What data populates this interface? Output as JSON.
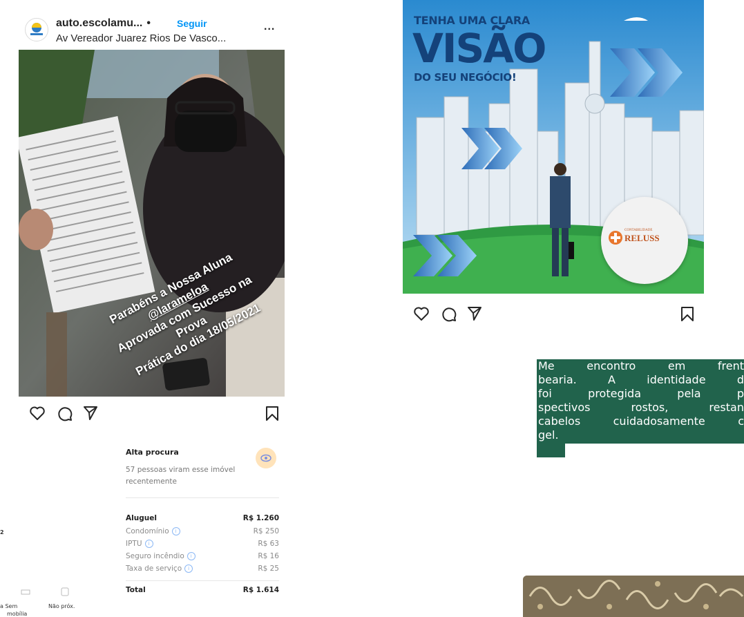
{
  "post1": {
    "username": "auto.escolamu...",
    "separator": "•",
    "follow_label": "Seguir",
    "location": "Av Vereador Juarez Rios De Vasco...",
    "more_label": "...",
    "caption": {
      "line1": "Parabéns a Nossa Aluna",
      "line2": "@larameloa",
      "line3": "Aprovada com Sucesso na Prova",
      "line4": "Prática do dia 18/05/2021"
    },
    "actions": [
      "heart-icon",
      "comment-icon",
      "share-icon",
      "bookmark-icon"
    ]
  },
  "post2": {
    "banner": {
      "title_top": "TENHA UMA CLARA",
      "title_main": "VISÃO",
      "title_bottom": "DO SEU NEGÓCIO!"
    },
    "logo": {
      "small_text": "CONTABILIDADE",
      "brand": "RELUSS"
    },
    "actions": [
      "heart-icon",
      "comment-icon",
      "share-icon",
      "bookmark-icon"
    ]
  },
  "greenbox": {
    "bg_color": "#21634c",
    "lines": [
      [
        "Me",
        "encontro",
        "em",
        "frent"
      ],
      [
        "bearia.",
        "A",
        "identidade",
        "d"
      ],
      [
        "foi",
        "protegida",
        "pela",
        "p"
      ],
      [
        "spectivos",
        "rostos,",
        "restan"
      ],
      [
        "cabelos",
        "cuidadosamente",
        "c"
      ],
      [
        "gel."
      ]
    ]
  },
  "rental": {
    "demand_title": "Alta procura",
    "demand_desc": "57 pessoas viram esse imóvel recentemente",
    "rows": [
      {
        "label": "Aluguel",
        "value": "R$ 1.260",
        "info": false,
        "bold": true
      },
      {
        "label": "Condomínio",
        "value": "R$ 250",
        "info": true,
        "bold": false
      },
      {
        "label": "IPTU",
        "value": "R$ 63",
        "info": true,
        "bold": false
      },
      {
        "label": "Seguro incêndio",
        "value": "R$ 16",
        "info": true,
        "bold": false
      },
      {
        "label": "Taxa de serviço",
        "value": "R$ 25",
        "info": true,
        "bold": false
      }
    ],
    "total": {
      "label": "Total",
      "value": "R$ 1.614"
    }
  },
  "fragments": {
    "f1": "2",
    "f2": "a Sem",
    "f3": "mobília",
    "f4": "Não próx."
  }
}
